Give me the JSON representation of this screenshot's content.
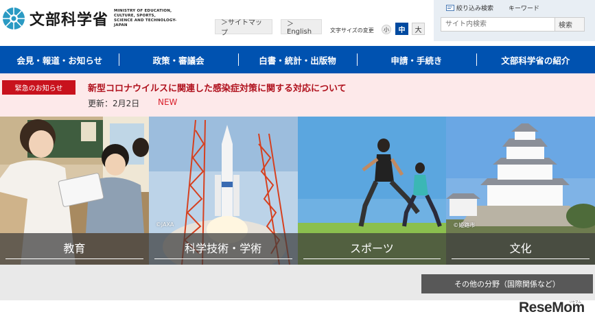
{
  "header": {
    "logo_jp": "文部科学省",
    "logo_en": [
      "MINISTRY OF EDUCATION,",
      "CULTURE, SPORTS,",
      "SCIENCE AND TECHNOLOGY-JAPAN"
    ],
    "sitemap": "＞サイトマップ",
    "english": "＞English",
    "font_size_label": "文字サイズの変更",
    "font_small": "小",
    "font_medium": "中",
    "font_large": "大"
  },
  "search": {
    "narrow_label": "絞り込み検索",
    "keyword_label": "キーワード",
    "placeholder": "サイト内検索",
    "button": "検索"
  },
  "nav": {
    "items": [
      "会見・報道・お知らせ",
      "政策・審議会",
      "白書・統計・出版物",
      "申請・手続き",
      "文部科学省の紹介"
    ]
  },
  "alert": {
    "badge": "緊急のお知らせ",
    "title": "新型コロナウイルスに関連した感染症対策に関する対応について",
    "date": "更新：2月2日",
    "new": "NEW"
  },
  "tiles": [
    {
      "label": "教育",
      "credit": ""
    },
    {
      "label": "科学技術・学術",
      "credit": "©JAXA"
    },
    {
      "label": "スポーツ",
      "credit": ""
    },
    {
      "label": "文化",
      "credit": "©姫路市"
    }
  ],
  "other_fields": "その他の分野（国際関係など）",
  "watermark": {
    "main": "ReseMom",
    "small": "リセマム"
  },
  "colors": {
    "nav_blue": "#0052b0",
    "alert_red": "#c8121d",
    "alert_bg": "#fde9ea"
  }
}
